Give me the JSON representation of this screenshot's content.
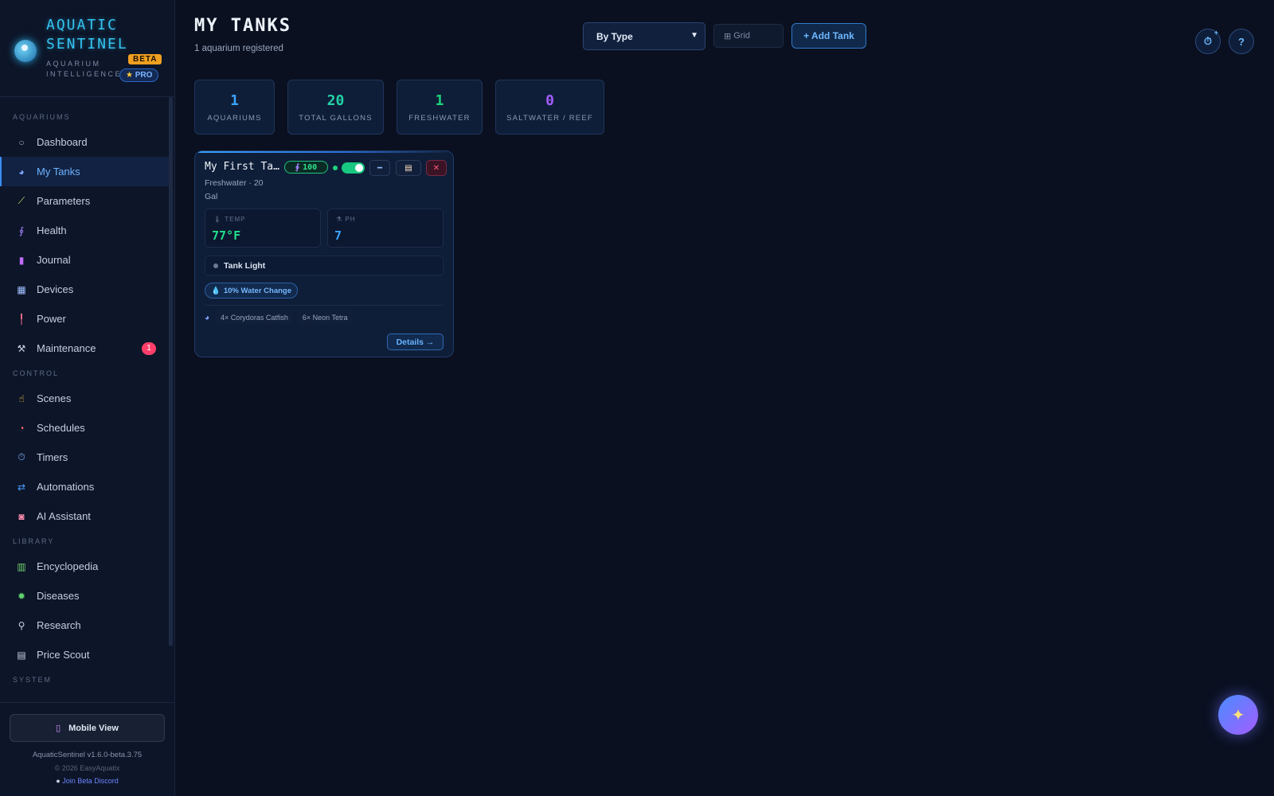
{
  "brand": {
    "title": "AQUATIC SENTINEL",
    "subtitle": "AQUARIUM INTELLIGENCE",
    "beta": "BETA",
    "pro": "PRO"
  },
  "nav": {
    "sections": {
      "aquariums": "AQUARIUMS",
      "control": "CONTROL",
      "library": "LIBRARY",
      "system": "SYSTEM"
    },
    "items": {
      "dashboard": "Dashboard",
      "my_tanks": "My Tanks",
      "parameters": "Parameters",
      "health": "Health",
      "journal": "Journal",
      "devices": "Devices",
      "power": "Power",
      "maintenance": "Maintenance",
      "scenes": "Scenes",
      "schedules": "Schedules",
      "timers": "Timers",
      "automations": "Automations",
      "ai_assistant": "AI Assistant",
      "encyclopedia": "Encyclopedia",
      "diseases": "Diseases",
      "research": "Research",
      "price_scout": "Price Scout"
    },
    "maintenance_badge": "1"
  },
  "footer": {
    "mobile_view": "Mobile View",
    "version": "AquaticSentinel v1.6.0-beta.3.75",
    "copyright": "© 2026 EasyAquatix",
    "discord": "Join Beta Discord"
  },
  "header": {
    "title": "MY TANKS",
    "subtitle": "1 aquarium registered",
    "sort_select": "By Type",
    "grid_label": "Grid",
    "add_tank": "+ Add Tank",
    "help": "?"
  },
  "stats": [
    {
      "value": "1",
      "label": "AQUARIUMS",
      "color": "#3aa3ff"
    },
    {
      "value": "20",
      "label": "TOTAL GALLONS",
      "color": "#22d3a8"
    },
    {
      "value": "1",
      "label": "FRESHWATER",
      "color": "#1fd07a"
    },
    {
      "value": "0",
      "label": "SALTWATER / REEF",
      "color": "#a15cff"
    }
  ],
  "tank": {
    "name": "My First Ta...",
    "type": "Freshwater · 20 Gal",
    "health_score": "100",
    "temp_label": "TEMP",
    "temp_value": "77°F",
    "ph_label": "PH",
    "ph_value": "7",
    "device": "Tank Light",
    "task": "10% Water Change",
    "livestock": [
      "4× Corydoras Catfish",
      "6× Neon Tetra"
    ],
    "details": "Details →"
  },
  "colors": {
    "accent": "#3aa3ff",
    "brand": "#33c4f0",
    "danger": "#ff3f6a",
    "success": "#20d37f"
  }
}
